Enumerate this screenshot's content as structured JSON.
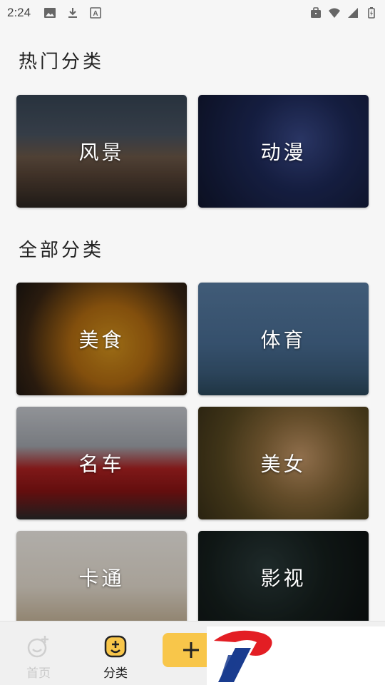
{
  "status": {
    "time": "2:24",
    "icons_left": [
      "image-icon",
      "download-icon",
      "a-icon"
    ],
    "icons_right": [
      "briefcase-icon",
      "wifi-icon",
      "signal-icon",
      "battery-icon"
    ]
  },
  "sections": {
    "hot_title": "热门分类",
    "all_title": "全部分类"
  },
  "hot": [
    {
      "label": "风景"
    },
    {
      "label": "动漫"
    }
  ],
  "all": [
    {
      "label": "美食"
    },
    {
      "label": "体育"
    },
    {
      "label": "名车"
    },
    {
      "label": "美女"
    },
    {
      "label": "卡通"
    },
    {
      "label": "影视"
    }
  ],
  "nav": {
    "home_label": "首页",
    "category_label": "分类",
    "add_label": "+",
    "accent": "#f8c64a"
  }
}
